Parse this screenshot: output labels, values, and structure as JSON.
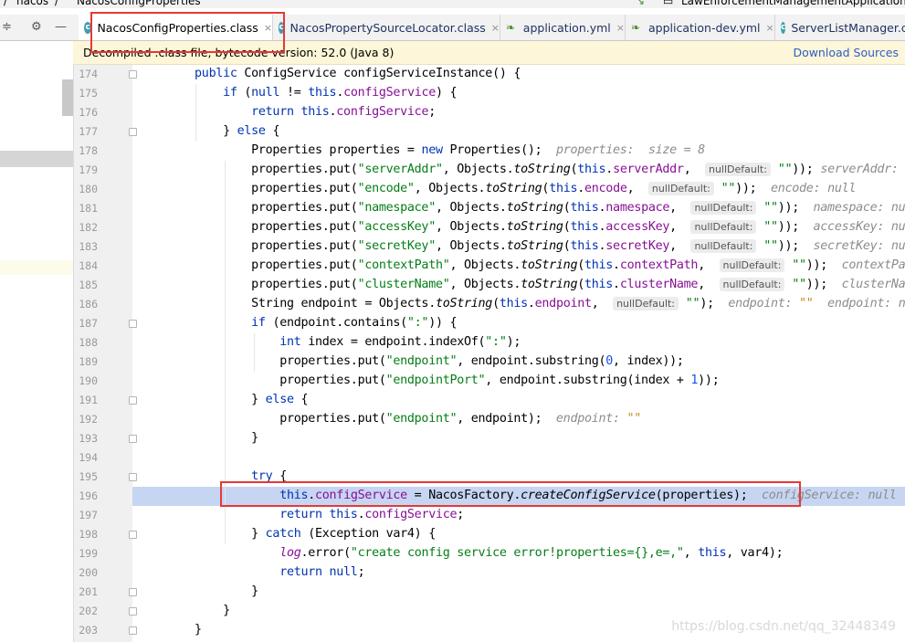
{
  "top_strip": {
    "breadcrumb_folder": "nacos",
    "breadcrumb_file": "NacosConfigProperties",
    "run_config": "LawEnforcementManagementApplication"
  },
  "tabs": [
    {
      "label": "NacosConfigProperties.class",
      "icon": "class-icon",
      "active": true,
      "close": "×"
    },
    {
      "label": "NacosPropertySourceLocator.class",
      "icon": "class-icon",
      "active": false,
      "close": "×"
    },
    {
      "label": "application.yml",
      "icon": "yaml-icon",
      "active": false,
      "close": "×"
    },
    {
      "label": "application-dev.yml",
      "icon": "yaml-icon",
      "active": false,
      "close": "×"
    },
    {
      "label": "ServerListManager.c",
      "icon": "class-icon",
      "active": false,
      "close": ""
    }
  ],
  "banner": {
    "message": "Decompiled .class file, bytecode version: 52.0 (Java 8)",
    "download_sources": "Download Sources"
  },
  "editor": {
    "lines": [
      {
        "num": "174",
        "code": [
          [
            "    public ",
            "k"
          ],
          [
            "ConfigService ",
            ""
          ],
          [
            "configServiceInstance",
            "m0"
          ],
          [
            "() {",
            ""
          ]
        ]
      },
      {
        "num": "175",
        "code": [
          [
            "        if ",
            "k"
          ],
          [
            "(",
            ""
          ],
          [
            "null ",
            "k"
          ],
          [
            "!= ",
            ""
          ],
          [
            "this",
            "k"
          ],
          [
            ".",
            ""
          ],
          [
            "configService",
            "f"
          ],
          [
            ") {",
            ""
          ]
        ]
      },
      {
        "num": "176",
        "code": [
          [
            "            return this",
            "k"
          ],
          [
            ".",
            ""
          ],
          [
            "configService",
            "f"
          ],
          [
            ";",
            ""
          ]
        ]
      },
      {
        "num": "177",
        "code": [
          [
            "        } ",
            ""
          ],
          [
            "else ",
            "k"
          ],
          [
            "{",
            ""
          ]
        ]
      },
      {
        "num": "178",
        "code": [
          [
            "            Properties properties = ",
            ""
          ],
          [
            "new ",
            "k"
          ],
          [
            "Properties();  ",
            ""
          ],
          [
            "properties:  size = 8",
            "h"
          ]
        ]
      },
      {
        "num": "179",
        "code": [
          [
            "            properties.put(",
            ""
          ],
          [
            "\"serverAddr\"",
            "s"
          ],
          [
            ", Objects.",
            ""
          ],
          [
            "toString",
            "m"
          ],
          [
            "(",
            ""
          ],
          [
            "this",
            "k"
          ],
          [
            ".",
            ""
          ],
          [
            "serverAddr",
            "f"
          ],
          [
            ",  ",
            ""
          ],
          [
            "nullDefault:",
            "p"
          ],
          [
            " ",
            ""
          ],
          [
            "\"\"",
            "s"
          ],
          [
            ")); ",
            ""
          ],
          [
            "serverAddr: null",
            "h"
          ]
        ]
      },
      {
        "num": "180",
        "code": [
          [
            "            properties.put(",
            ""
          ],
          [
            "\"encode\"",
            "s"
          ],
          [
            ", Objects.",
            ""
          ],
          [
            "toString",
            "m"
          ],
          [
            "(",
            ""
          ],
          [
            "this",
            "k"
          ],
          [
            ".",
            ""
          ],
          [
            "encode",
            "f"
          ],
          [
            ",  ",
            ""
          ],
          [
            "nullDefault:",
            "p"
          ],
          [
            " ",
            ""
          ],
          [
            "\"\"",
            "s"
          ],
          [
            "));  ",
            ""
          ],
          [
            "encode: null",
            "h"
          ]
        ]
      },
      {
        "num": "181",
        "code": [
          [
            "            properties.put(",
            ""
          ],
          [
            "\"namespace\"",
            "s"
          ],
          [
            ", Objects.",
            ""
          ],
          [
            "toString",
            "m"
          ],
          [
            "(",
            ""
          ],
          [
            "this",
            "k"
          ],
          [
            ".",
            ""
          ],
          [
            "namespace",
            "f"
          ],
          [
            ",  ",
            ""
          ],
          [
            "nullDefault:",
            "p"
          ],
          [
            " ",
            ""
          ],
          [
            "\"\"",
            "s"
          ],
          [
            "));  ",
            ""
          ],
          [
            "namespace: null",
            "h"
          ]
        ]
      },
      {
        "num": "182",
        "code": [
          [
            "            properties.put(",
            ""
          ],
          [
            "\"accessKey\"",
            "s"
          ],
          [
            ", Objects.",
            ""
          ],
          [
            "toString",
            "m"
          ],
          [
            "(",
            ""
          ],
          [
            "this",
            "k"
          ],
          [
            ".",
            ""
          ],
          [
            "accessKey",
            "f"
          ],
          [
            ",  ",
            ""
          ],
          [
            "nullDefault:",
            "p"
          ],
          [
            " ",
            ""
          ],
          [
            "\"\"",
            "s"
          ],
          [
            "));  ",
            ""
          ],
          [
            "accessKey: null",
            "h"
          ]
        ]
      },
      {
        "num": "183",
        "code": [
          [
            "            properties.put(",
            ""
          ],
          [
            "\"secretKey\"",
            "s"
          ],
          [
            ", Objects.",
            ""
          ],
          [
            "toString",
            "m"
          ],
          [
            "(",
            ""
          ],
          [
            "this",
            "k"
          ],
          [
            ".",
            ""
          ],
          [
            "secretKey",
            "f"
          ],
          [
            ",  ",
            ""
          ],
          [
            "nullDefault:",
            "p"
          ],
          [
            " ",
            ""
          ],
          [
            "\"\"",
            "s"
          ],
          [
            "));  ",
            ""
          ],
          [
            "secretKey: null",
            "h"
          ]
        ]
      },
      {
        "num": "184",
        "code": [
          [
            "            properties.put(",
            ""
          ],
          [
            "\"contextPath\"",
            "s"
          ],
          [
            ", Objects.",
            ""
          ],
          [
            "toString",
            "m"
          ],
          [
            "(",
            ""
          ],
          [
            "this",
            "k"
          ],
          [
            ".",
            ""
          ],
          [
            "contextPath",
            "f"
          ],
          [
            ",  ",
            ""
          ],
          [
            "nullDefault:",
            "p"
          ],
          [
            " ",
            ""
          ],
          [
            "\"\"",
            "s"
          ],
          [
            "));  ",
            ""
          ],
          [
            "contextPath:",
            "h"
          ]
        ]
      },
      {
        "num": "185",
        "code": [
          [
            "            properties.put(",
            ""
          ],
          [
            "\"clusterName\"",
            "s"
          ],
          [
            ", Objects.",
            ""
          ],
          [
            "toString",
            "m"
          ],
          [
            "(",
            ""
          ],
          [
            "this",
            "k"
          ],
          [
            ".",
            ""
          ],
          [
            "clusterName",
            "f"
          ],
          [
            ",  ",
            ""
          ],
          [
            "nullDefault:",
            "p"
          ],
          [
            " ",
            ""
          ],
          [
            "\"\"",
            "s"
          ],
          [
            "));  ",
            ""
          ],
          [
            "clusterName:",
            "h"
          ]
        ]
      },
      {
        "num": "186",
        "code": [
          [
            "            String endpoint = Objects.",
            ""
          ],
          [
            "toString",
            "m"
          ],
          [
            "(",
            ""
          ],
          [
            "this",
            "k"
          ],
          [
            ".",
            ""
          ],
          [
            "endpoint",
            "f"
          ],
          [
            ",  ",
            ""
          ],
          [
            "nullDefault:",
            "p"
          ],
          [
            " ",
            ""
          ],
          [
            "\"\"",
            "s"
          ],
          [
            ");  ",
            ""
          ],
          [
            "endpoint: ",
            "h"
          ],
          [
            "\"\"",
            "hs"
          ],
          [
            "  endpoint: null",
            "h"
          ]
        ]
      },
      {
        "num": "187",
        "code": [
          [
            "            if ",
            "k"
          ],
          [
            "(endpoint.contains(",
            ""
          ],
          [
            "\":\"",
            "s"
          ],
          [
            ")) {",
            ""
          ]
        ]
      },
      {
        "num": "188",
        "code": [
          [
            "                int ",
            "k"
          ],
          [
            "index = endpoint.indexOf(",
            ""
          ],
          [
            "\":\"",
            "s"
          ],
          [
            ");",
            ""
          ]
        ]
      },
      {
        "num": "189",
        "code": [
          [
            "                properties.put(",
            ""
          ],
          [
            "\"endpoint\"",
            "s"
          ],
          [
            ", endpoint.substring(",
            ""
          ],
          [
            "0",
            "n"
          ],
          [
            ", index));",
            ""
          ]
        ]
      },
      {
        "num": "190",
        "code": [
          [
            "                properties.put(",
            ""
          ],
          [
            "\"endpointPort\"",
            "s"
          ],
          [
            ", endpoint.substring(index + ",
            ""
          ],
          [
            "1",
            "n"
          ],
          [
            "));",
            ""
          ]
        ]
      },
      {
        "num": "191",
        "code": [
          [
            "            } ",
            ""
          ],
          [
            "else ",
            "k"
          ],
          [
            "{",
            ""
          ]
        ]
      },
      {
        "num": "192",
        "code": [
          [
            "                properties.put(",
            ""
          ],
          [
            "\"endpoint\"",
            "s"
          ],
          [
            ", endpoint);  ",
            ""
          ],
          [
            "endpoint: ",
            "h"
          ],
          [
            "\"\"",
            "hs"
          ]
        ]
      },
      {
        "num": "193",
        "code": [
          [
            "            }",
            ""
          ]
        ]
      },
      {
        "num": "194",
        "code": [
          [
            "",
            ""
          ]
        ]
      },
      {
        "num": "195",
        "code": [
          [
            "            try ",
            "k"
          ],
          [
            "{",
            ""
          ]
        ]
      },
      {
        "num": "196",
        "code": [
          [
            "                this",
            "k"
          ],
          [
            ".",
            ""
          ],
          [
            "configService",
            "f"
          ],
          [
            " = NacosFactory.",
            ""
          ],
          [
            "createConfigService",
            "m"
          ],
          [
            "(properties);  ",
            ""
          ],
          [
            "configService: null",
            "h"
          ]
        ],
        "selected": true
      },
      {
        "num": "197",
        "code": [
          [
            "                return this",
            "k"
          ],
          [
            ".",
            ""
          ],
          [
            "configService",
            "f"
          ],
          [
            ";",
            ""
          ]
        ]
      },
      {
        "num": "198",
        "code": [
          [
            "            } ",
            ""
          ],
          [
            "catch ",
            "k"
          ],
          [
            "(Exception var4) {",
            ""
          ]
        ]
      },
      {
        "num": "199",
        "code": [
          [
            "                ",
            ""
          ],
          [
            "log",
            "fm"
          ],
          [
            ".error(",
            ""
          ],
          [
            "\"create config service error!properties={},e=,\"",
            "s"
          ],
          [
            ", ",
            ""
          ],
          [
            "this",
            "k"
          ],
          [
            ", var4);",
            ""
          ]
        ]
      },
      {
        "num": "200",
        "code": [
          [
            "                return null",
            "k"
          ],
          [
            ";",
            ""
          ]
        ]
      },
      {
        "num": "201",
        "code": [
          [
            "            }",
            ""
          ]
        ]
      },
      {
        "num": "202",
        "code": [
          [
            "        }",
            ""
          ]
        ]
      },
      {
        "num": "203",
        "code": [
          [
            "    }",
            ""
          ]
        ]
      }
    ]
  },
  "watermark": "https://blog.csdn.net/qq_32448349",
  "colors": {
    "keyword": "#0033b3",
    "string": "#067d17",
    "field": "#871094",
    "number": "#1750eb",
    "hint": "#8c8c8c",
    "selection": "#c6d5f2",
    "annotation_box": "#e53935"
  }
}
